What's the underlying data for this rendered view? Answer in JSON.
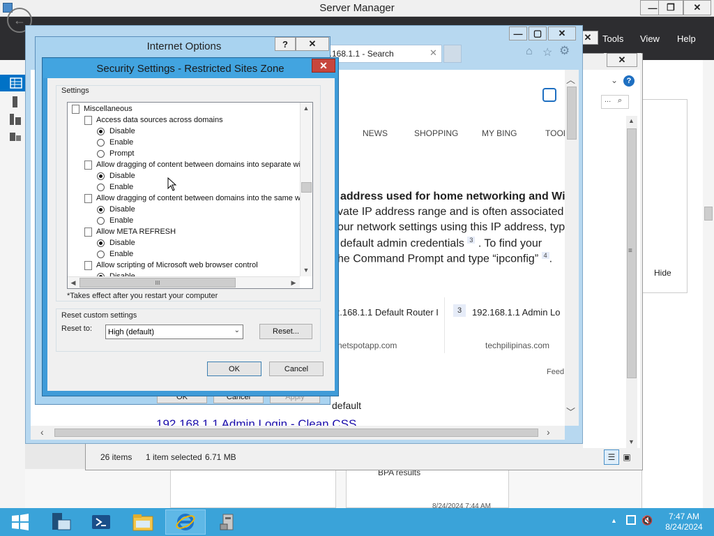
{
  "server_manager": {
    "title": "Server Manager",
    "menu": {
      "tools": "Tools",
      "view": "View",
      "help": "Help"
    },
    "hide_button": "Hide",
    "bpa_results": "BPA results",
    "bpa_timestamp": "8/24/2024 7:44 AM",
    "window_controls": {
      "minimize": "—",
      "maximize": "❐",
      "close": "✕"
    }
  },
  "explorer": {
    "status_items": "26 items",
    "status_selected": "1 item selected",
    "status_size": "6.71 MB",
    "search_placeholder": "..."
  },
  "ie": {
    "tab_title": "2.168.1.1 - Search",
    "bing_nav": [
      "NEWS",
      "SHOPPING",
      "MY BING",
      "TOOL"
    ],
    "article_lines": [
      "address used for home networking and Wi",
      "vate IP address range and is often associated",
      "our network settings using this IP address, type",
      "default admin credentials",
      "he Command Prompt and type “ipconfig”"
    ],
    "article_end_3": ". To find your",
    "article_end_4": ".",
    "cite_3": "3",
    "cite_4": "4",
    "card1_title": "2.168.1.1 Default Router I",
    "card1_num": "3",
    "card2_title": "192.168.1.1 Admin Lo",
    "card1_source": "netspotapp.com",
    "card2_source": "techpilipinas.com",
    "feedback": "Feed",
    "lower_text": "default",
    "lower_link": "192.168.1.1 Admin Login - Clean CSS"
  },
  "internet_options": {
    "title": "Internet Options",
    "help_btn": "?",
    "close_btn": "✕",
    "ok": "OK",
    "cancel": "Cancel",
    "apply": "Apply"
  },
  "security_settings": {
    "title": "Security Settings - Restricted Sites Zone",
    "close_btn": "✕",
    "settings_label": "Settings",
    "tree": [
      {
        "kind": "category",
        "text": "Miscellaneous"
      },
      {
        "kind": "setting",
        "text": "Access data sources across domains"
      },
      {
        "kind": "option",
        "text": "Disable",
        "checked": true
      },
      {
        "kind": "option",
        "text": "Enable",
        "checked": false
      },
      {
        "kind": "option",
        "text": "Prompt",
        "checked": false
      },
      {
        "kind": "setting",
        "text": "Allow dragging of content between domains into separate wi"
      },
      {
        "kind": "option",
        "text": "Disable",
        "checked": true
      },
      {
        "kind": "option",
        "text": "Enable",
        "checked": false
      },
      {
        "kind": "setting",
        "text": "Allow dragging of content between domains into the same wi"
      },
      {
        "kind": "option",
        "text": "Disable",
        "checked": true
      },
      {
        "kind": "option",
        "text": "Enable",
        "checked": false
      },
      {
        "kind": "setting",
        "text": "Allow META REFRESH"
      },
      {
        "kind": "option",
        "text": "Disable",
        "checked": true
      },
      {
        "kind": "option",
        "text": "Enable",
        "checked": false
      },
      {
        "kind": "setting",
        "text": "Allow scripting of Microsoft web browser control"
      },
      {
        "kind": "option",
        "text": "Disable",
        "checked": true
      }
    ],
    "restart_note": "*Takes effect after you restart your computer",
    "reset_group_label": "Reset custom settings",
    "reset_to_label": "Reset to:",
    "reset_to_value": "High (default)",
    "reset_button": "Reset...",
    "ok": "OK",
    "cancel": "Cancel",
    "hscroll_grip": "III"
  },
  "taskbar": {
    "time": "7:47 AM",
    "date": "8/24/2024",
    "apps": [
      "start-icon",
      "server-manager-icon",
      "powershell-icon",
      "file-explorer-icon",
      "internet-explorer-icon",
      "tools-icon"
    ]
  },
  "colors": {
    "taskbar": "#3aa3d9",
    "dialog_frame": "#3f9bd8",
    "close_red": "#c7463d",
    "sm_dark": "#2d2d30"
  }
}
